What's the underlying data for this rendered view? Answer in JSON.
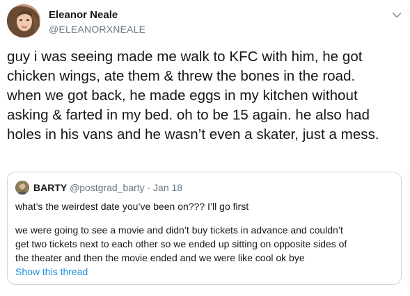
{
  "tweet": {
    "author": {
      "name": "Eleanor Neale",
      "handle": "@ELEANORXNEALE"
    },
    "text_lines": [
      "guy i was seeing made me walk to KFC with him, he got",
      "chicken wings, ate them & threw the bones in the road.",
      "when we got back, he made eggs in my kitchen without",
      "asking & farted in my bed. oh to be 15 again. he also had",
      "holes in his vans and he wasn’t even a skater, just a mess."
    ],
    "menu_icon": "chevron-down-icon"
  },
  "quoted_tweet": {
    "author_name": "BARTY",
    "meta": "@postgrad_barty · Jan 18",
    "lines": [
      "what’s the weirdest date you’ve been on??? I’ll go first",
      "we were going to see a movie and didn’t buy tickets in advance and couldn’t",
      "get two tickets next to each other so we ended up sitting on opposite sides of",
      "the theater and then the movie ended and we were like cool ok bye"
    ],
    "show_thread_label": "Show this thread"
  },
  "colors": {
    "text": "#14171a",
    "secondary_text": "#657786",
    "link": "#1b95e0",
    "border": "#ccd6dd"
  }
}
